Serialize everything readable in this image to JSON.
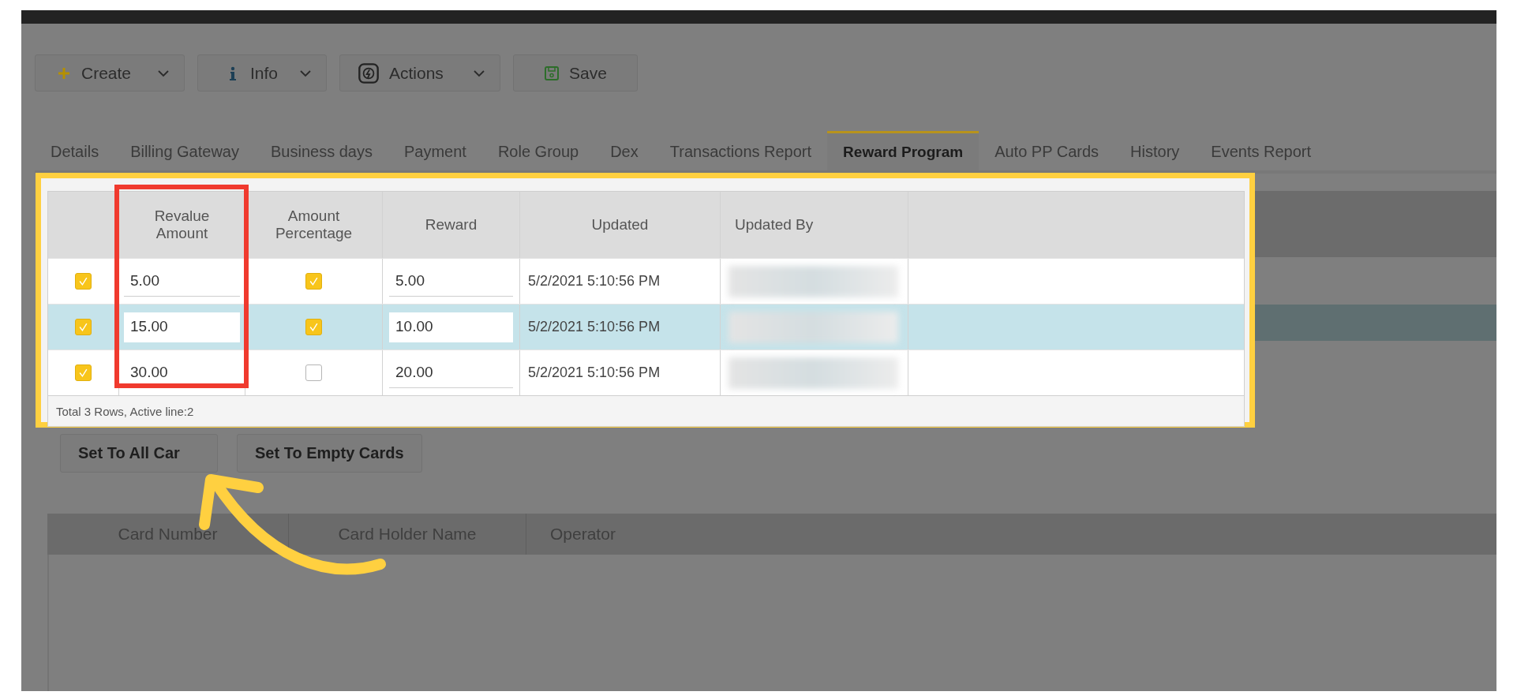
{
  "toolbar": [
    {
      "label": "Create",
      "kind": "create",
      "dropdown": true
    },
    {
      "label": "Info",
      "kind": "info",
      "dropdown": true
    },
    {
      "label": "Actions",
      "kind": "actions",
      "dropdown": true
    },
    {
      "label": "Save",
      "kind": "save",
      "dropdown": false
    }
  ],
  "tabs": [
    {
      "label": "Details",
      "selected": false
    },
    {
      "label": "Billing Gateway",
      "selected": false
    },
    {
      "label": "Business days",
      "selected": false
    },
    {
      "label": "Payment",
      "selected": false
    },
    {
      "label": "Role Group",
      "selected": false
    },
    {
      "label": "Dex",
      "selected": false
    },
    {
      "label": "Transactions Report",
      "selected": false
    },
    {
      "label": "Reward Program",
      "selected": true
    },
    {
      "label": "Auto PP Cards",
      "selected": false
    },
    {
      "label": "History",
      "selected": false
    },
    {
      "label": "Events Report",
      "selected": false
    }
  ],
  "grid": {
    "columns": [
      "Revalue Amount",
      "Amount Percentage",
      "Reward",
      "Updated",
      "Updated By"
    ],
    "rows": [
      {
        "checked": true,
        "revalue_amount": "5.00",
        "amount_percentage": true,
        "reward": "5.00",
        "updated": "5/2/2021 5:10:56 PM",
        "selected": false
      },
      {
        "checked": true,
        "revalue_amount": "15.00",
        "amount_percentage": true,
        "reward": "10.00",
        "updated": "5/2/2021 5:10:56 PM",
        "selected": true
      },
      {
        "checked": true,
        "revalue_amount": "30.00",
        "amount_percentage": false,
        "reward": "20.00",
        "updated": "5/2/2021 5:10:56 PM",
        "selected": false
      }
    ],
    "footer": "Total 3 Rows, Active line:2"
  },
  "buttons": [
    "Set To All Car",
    "Set To Empty Cards"
  ],
  "cards_table": {
    "columns": [
      "Card Number",
      "Card Holder Name",
      "Operator"
    ]
  }
}
